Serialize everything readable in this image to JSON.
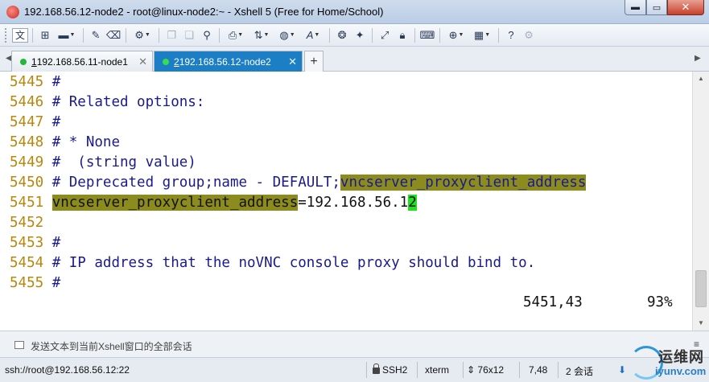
{
  "window": {
    "title": "192.168.56.12-node2 - root@linux-node2:~ - Xshell 5 (Free for Home/School)",
    "min_glyph": "▬",
    "max_glyph": "▭",
    "close_glyph": "✕"
  },
  "toolbar": {
    "lang_label": "文",
    "icons": [
      "new-session-icon",
      "open-folder-icon",
      "pencil-icon",
      "eraser-icon",
      "properties-icon",
      "copy-icon",
      "paste-icon",
      "find-icon",
      "print-icon",
      "transfer-icon",
      "globe-icon",
      "font-icon",
      "xftp-icon",
      "xmanager-icon",
      "fullscreen-icon",
      "lock-icon",
      "keyboard-icon",
      "add-icon",
      "layout-icon",
      "help-icon",
      "settings-icon"
    ]
  },
  "tabs": [
    {
      "num": "1",
      "label": " 192.168.56.11-node1",
      "active": false
    },
    {
      "num": "2",
      "label": " 192.168.56.12-node2",
      "active": true
    }
  ],
  "terminal": {
    "lines": [
      {
        "num": "5445",
        "text": " #"
      },
      {
        "num": "5446",
        "text": " # Related options:"
      },
      {
        "num": "5447",
        "text": " #"
      },
      {
        "num": "5448",
        "text": " # * None"
      },
      {
        "num": "5449",
        "text": " #  (string value)"
      },
      {
        "num": "5450",
        "text": " # Deprecated group;name - DEFAULT;",
        "highlight": "vncserver_proxyclient_address"
      },
      {
        "num": "5451",
        "text": "",
        "highlight": "vncserver_proxyclient_address",
        "after": "=192.168.56.1",
        "cursor": "2"
      },
      {
        "num": "5452",
        "text": ""
      },
      {
        "num": "5453",
        "text": " #"
      },
      {
        "num": "5454",
        "text": " # IP address that the noVNC console proxy should bind to."
      },
      {
        "num": "5455",
        "text": " #"
      }
    ],
    "position": "5451,43",
    "percent": "93%"
  },
  "compose": {
    "placeholder": "发送文本到当前Xshell窗口的全部会话"
  },
  "statusbar": {
    "connection": "ssh://root@192.168.56.12:22",
    "protocol": "SSH2",
    "terminal_type": "xterm",
    "size": "76x12",
    "cursor_pos": "7,48",
    "sessions": "2 会话"
  },
  "watermark": {
    "text": "运维网",
    "sub": "iyunv.com"
  }
}
